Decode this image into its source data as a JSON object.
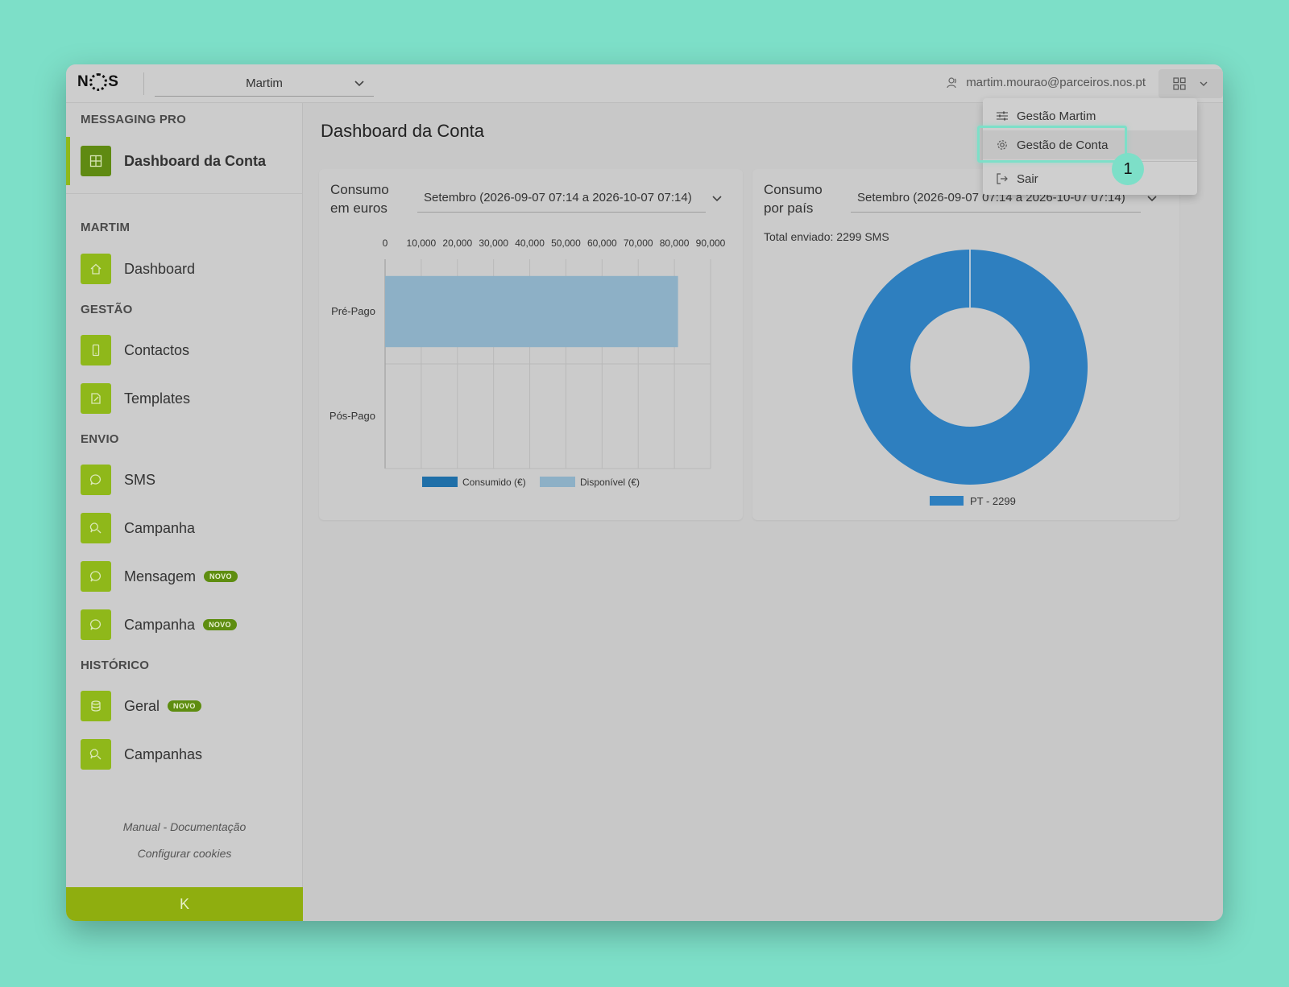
{
  "header": {
    "logo_left": "N",
    "logo_right": "S",
    "account": "Martim",
    "user_email": "martim.mourao@parceiros.nos.pt"
  },
  "sidebar": {
    "app_section": "MESSAGING PRO",
    "active_item": "Dashboard da Conta",
    "sections": {
      "martim": "MARTIM",
      "gestao": "GESTÃO",
      "envio": "ENVIO",
      "historico": "HISTÓRICO"
    },
    "items": {
      "dashboard": "Dashboard",
      "contactos": "Contactos",
      "templates": "Templates",
      "sms": "SMS",
      "campanha": "Campanha",
      "mensagem": "Mensagem",
      "campanha2": "Campanha",
      "geral": "Geral",
      "campanhas": "Campanhas"
    },
    "badge": "NOVO",
    "manual_link": "Manual - Documentação",
    "cookies_link": "Configurar cookies",
    "collapse_label": "K"
  },
  "main": {
    "title": "Dashboard da Conta",
    "card_euros": {
      "title": "Consumo em euros",
      "period": "Setembro (2026-09-07 07:14 a 2026-10-07 07:14)"
    },
    "card_pais": {
      "title": "Consumo por país",
      "period": "Setembro (2026-09-07 07:14 a 2026-10-07 07:14)",
      "total_sent": "Total enviado: 2299 SMS"
    }
  },
  "menu": {
    "gestao_martim": "Gestão Martim",
    "gestao_conta": "Gestão de Conta",
    "sair": "Sair"
  },
  "annotation": {
    "step": "1"
  },
  "colors": {
    "accent_green": "#8fb81a",
    "highlight": "#7ddfc8",
    "consumido": "#1f6fa8",
    "disponivel": "#8db0c6",
    "pie_pt": "#2e7fbf"
  },
  "chart_data": [
    {
      "type": "bar",
      "orientation": "horizontal",
      "stacked": true,
      "categories": [
        "Pré-Pago",
        "Pós-Pago"
      ],
      "series": [
        {
          "name": "Consumido (€)",
          "values": [
            0,
            0
          ]
        },
        {
          "name": "Disponível (€)",
          "values": [
            81000,
            0
          ]
        }
      ],
      "xlim": [
        0,
        90000
      ],
      "xticks": [
        "0",
        "10,000",
        "20,000",
        "30,000",
        "40,000",
        "50,000",
        "60,000",
        "70,000",
        "80,000",
        "90,000"
      ],
      "legend": "bottom",
      "grid": true
    },
    {
      "type": "pie",
      "donut": true,
      "labels": [
        "PT - 2299"
      ],
      "values": [
        2299
      ],
      "legend": "bottom"
    }
  ]
}
